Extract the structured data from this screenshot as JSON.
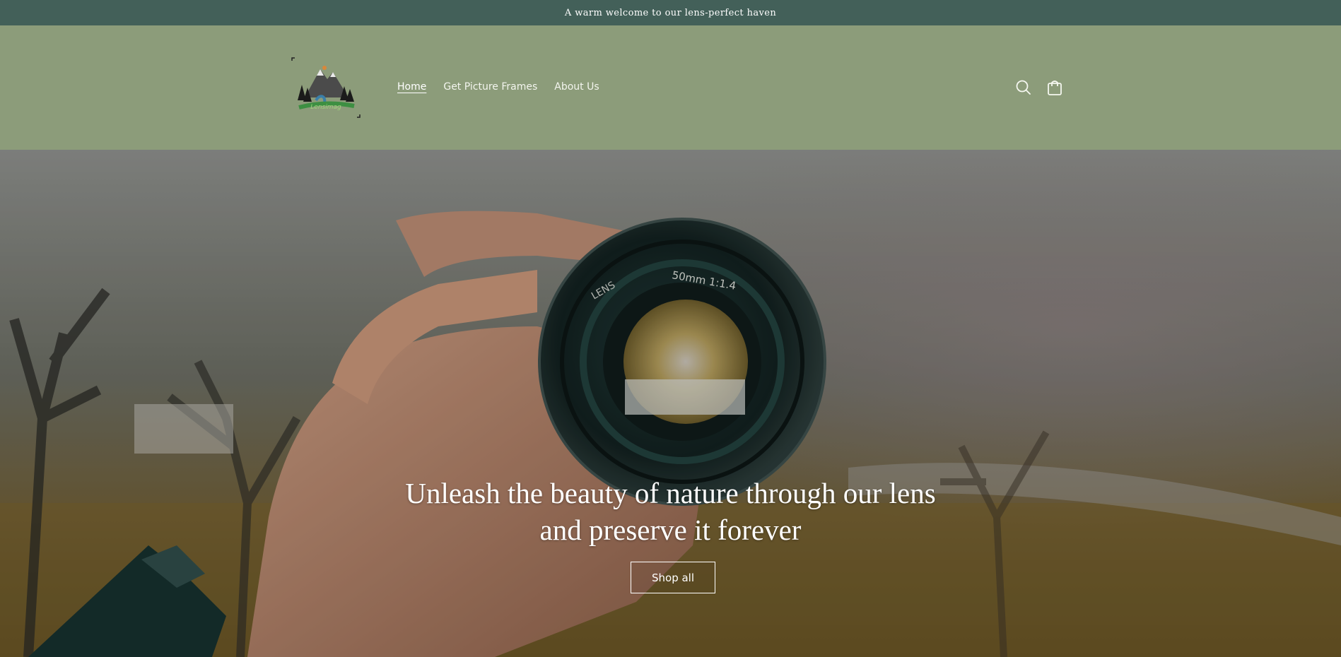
{
  "announcement": {
    "text": "A warm welcome to our lens-perfect haven"
  },
  "header": {
    "logo_alt": "Lensimag",
    "nav": [
      {
        "label": "Home",
        "active": true
      },
      {
        "label": "Get Picture Frames",
        "active": false
      },
      {
        "label": "About Us",
        "active": false
      }
    ],
    "icons": [
      "search-icon",
      "cart-icon"
    ]
  },
  "hero": {
    "title_line1": "Unleash the beauty of nature through our lens",
    "title_line2": "and preserve it forever",
    "button_label": "Shop all",
    "lens_text": {
      "brand": "LENS",
      "spec": "50mm  1:1.4"
    }
  },
  "colors": {
    "announcement_bg": "#436059",
    "header_bg": "#8c9c7a",
    "text_light": "#ffffff"
  }
}
